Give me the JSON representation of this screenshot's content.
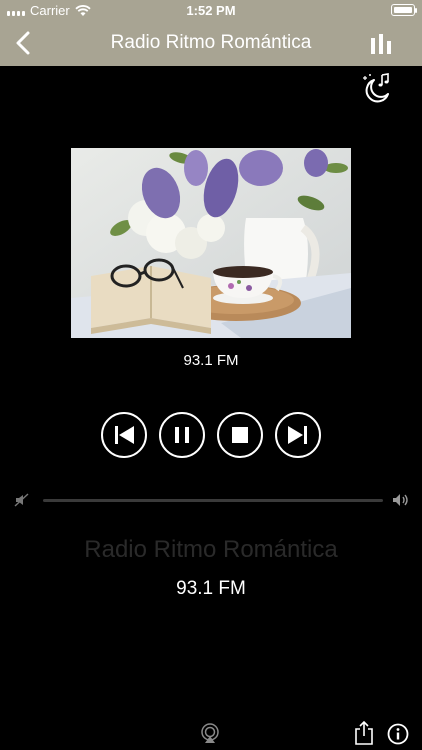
{
  "status_bar": {
    "carrier": "Carrier",
    "time": "1:52 PM"
  },
  "nav": {
    "title": "Radio Ritmo Romántica"
  },
  "player": {
    "frequency_label": "93.1 FM",
    "volume_level": 0
  },
  "now_playing": {
    "station": "Radio Ritmo Romántica",
    "frequency": "93.1 FM"
  },
  "colors": {
    "nav_background": "#a8a493",
    "background": "#000000",
    "station_name": "#2a2a2a"
  },
  "icons": [
    "back-icon",
    "equalizer-icon",
    "sleep-timer-icon",
    "previous-icon",
    "pause-icon",
    "stop-icon",
    "next-icon",
    "volume-mute-icon",
    "volume-high-icon",
    "airplay-icon",
    "share-icon",
    "info-icon"
  ]
}
